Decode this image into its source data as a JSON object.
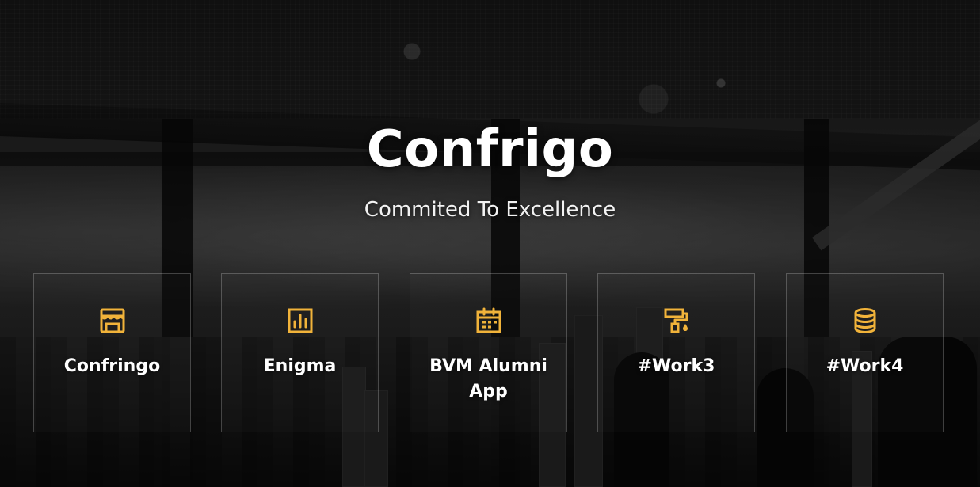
{
  "hero": {
    "title": "Confrigo",
    "subtitle": "Commited To Excellence"
  },
  "theme": {
    "accent": "#f1b33a",
    "text": "#ffffff"
  },
  "cards": [
    {
      "label": "Confringo",
      "icon": "storefront-icon"
    },
    {
      "label": "Enigma",
      "icon": "bar-chart-icon"
    },
    {
      "label": "BVM Alumni App",
      "icon": "calendar-icon"
    },
    {
      "label": "#Work3",
      "icon": "paint-roller-icon"
    },
    {
      "label": "#Work4",
      "icon": "database-icon"
    }
  ]
}
